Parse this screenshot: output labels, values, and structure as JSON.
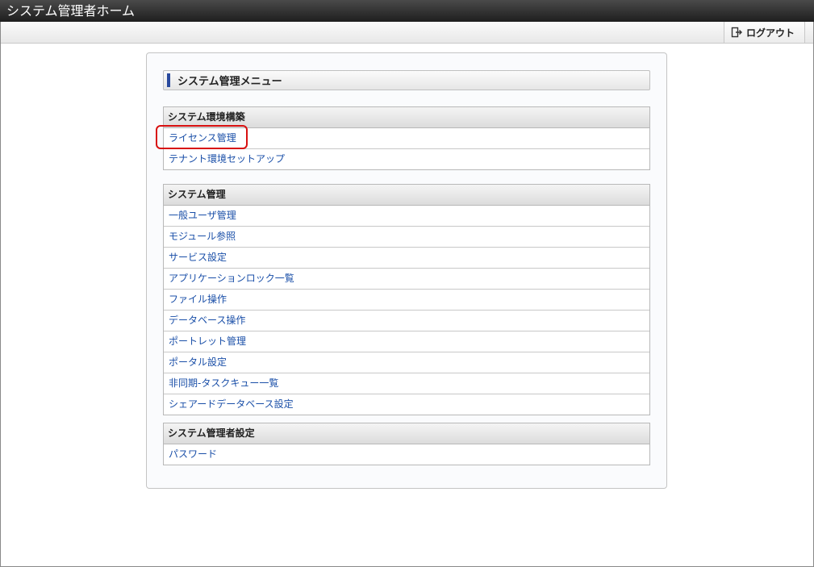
{
  "window": {
    "title": "システム管理者ホーム"
  },
  "toolbar": {
    "logout_label": "ログアウト",
    "logout_icon": "logout-icon"
  },
  "panel": {
    "title": "システム管理メニュー",
    "sections": [
      {
        "heading": "システム環境構築",
        "items": [
          "ライセンス管理",
          "テナント環境セットアップ"
        ]
      },
      {
        "heading": "システム管理",
        "items": [
          "一般ユーザ管理",
          "モジュール参照",
          "サービス設定",
          "アプリケーションロック一覧",
          "ファイル操作",
          "データベース操作",
          "ポートレット管理",
          "ポータル設定",
          "非同期-タスクキュー一覧",
          "シェアードデータベース設定"
        ]
      },
      {
        "heading": "システム管理者設定",
        "items": [
          "パスワード"
        ]
      }
    ]
  },
  "annotation": {
    "highlight_color": "#d81010"
  }
}
